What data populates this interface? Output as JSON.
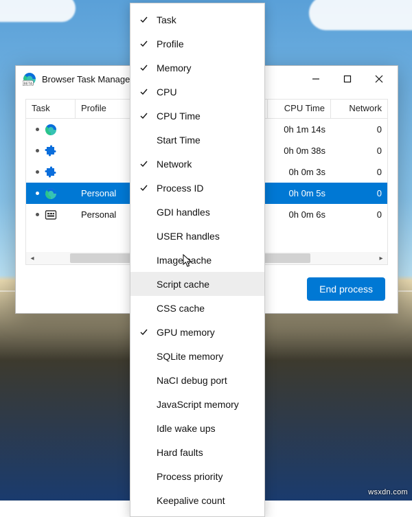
{
  "window": {
    "title": "Browser Task Manager",
    "end_process_label": "End process"
  },
  "columns": {
    "task": "Task",
    "profile": "Profile",
    "cpu_time": "CPU Time",
    "network": "Network"
  },
  "rows": [
    {
      "icon": "edge",
      "profile": "",
      "cpu_time": "0h 1m 14s",
      "network": "0",
      "selected": false
    },
    {
      "icon": "puzzle",
      "profile": "",
      "cpu_time": "0h 0m 38s",
      "network": "0",
      "selected": false
    },
    {
      "icon": "puzzle",
      "profile": "",
      "cpu_time": "0h 0m 3s",
      "network": "0",
      "selected": false
    },
    {
      "icon": "edge",
      "profile": "Personal",
      "cpu_time": "0h 0m 5s",
      "network": "0",
      "selected": true
    },
    {
      "icon": "native",
      "profile": "Personal",
      "cpu_time": "0h 0m 6s",
      "network": "0",
      "selected": false
    }
  ],
  "menu": [
    {
      "label": "Task",
      "checked": true
    },
    {
      "label": "Profile",
      "checked": true
    },
    {
      "label": "Memory",
      "checked": true
    },
    {
      "label": "CPU",
      "checked": true
    },
    {
      "label": "CPU Time",
      "checked": true
    },
    {
      "label": "Start Time",
      "checked": false
    },
    {
      "label": "Network",
      "checked": true
    },
    {
      "label": "Process ID",
      "checked": true
    },
    {
      "label": "GDI handles",
      "checked": false
    },
    {
      "label": "USER handles",
      "checked": false
    },
    {
      "label": "Image cache",
      "checked": false
    },
    {
      "label": "Script cache",
      "checked": false,
      "hovered": true
    },
    {
      "label": "CSS cache",
      "checked": false
    },
    {
      "label": "GPU memory",
      "checked": true
    },
    {
      "label": "SQLite memory",
      "checked": false
    },
    {
      "label": "NaCI debug port",
      "checked": false
    },
    {
      "label": "JavaScript memory",
      "checked": false
    },
    {
      "label": "Idle wake ups",
      "checked": false
    },
    {
      "label": "Hard faults",
      "checked": false
    },
    {
      "label": "Process priority",
      "checked": false
    },
    {
      "label": "Keepalive count",
      "checked": false
    }
  ],
  "watermark": "wsxdn.com"
}
